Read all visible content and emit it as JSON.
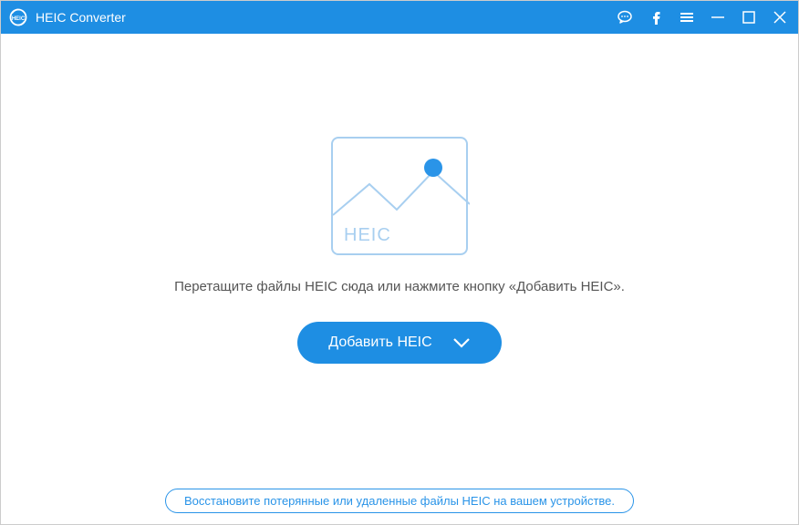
{
  "titlebar": {
    "app_title": "HEIC Converter"
  },
  "main": {
    "placeholder_label": "HEIC",
    "drop_text": "Перетащите файлы HEIC сюда или нажмите кнопку «Добавить HEIC».",
    "add_button_label": "Добавить HEIC"
  },
  "footer": {
    "recovery_link": "Восстановите потерянные или удаленные файлы HEIC на вашем устройстве."
  },
  "colors": {
    "primary": "#1e8ee3",
    "accent": "#2a94e8",
    "placeholder_border": "#a8cff0"
  }
}
